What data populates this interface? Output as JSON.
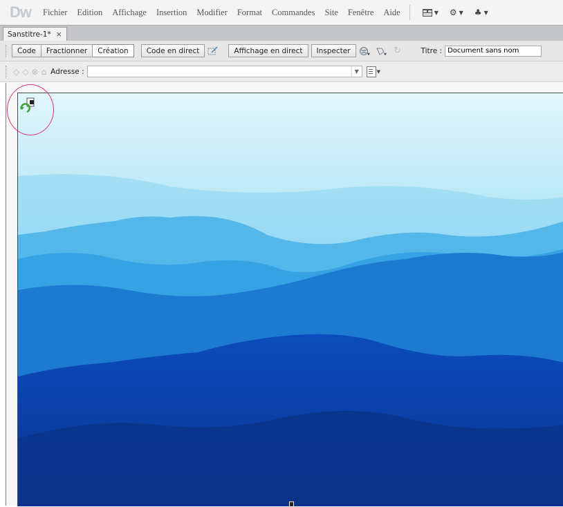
{
  "app": {
    "logo": "Dw"
  },
  "menu": [
    "Fichier",
    "Edition",
    "Affichage",
    "Insertion",
    "Modifier",
    "Format",
    "Commandes",
    "Site",
    "Fenêtre",
    "Aide"
  ],
  "tab": {
    "label": "Sanstitre-1*",
    "close": "×"
  },
  "toolbar": {
    "code": "Code",
    "split": "Fractionner",
    "design": "Création",
    "live_code": "Code en direct",
    "live_view": "Affichage en direct",
    "inspect": "Inspecter",
    "title_label": "Titre :",
    "title_value": "Document sans nom"
  },
  "address": {
    "label": "Adresse :",
    "value": ""
  },
  "colors": {
    "highlight": "#e0307e",
    "sky": "#d9f2fb",
    "mountain_deep": "#0a3a9e"
  }
}
